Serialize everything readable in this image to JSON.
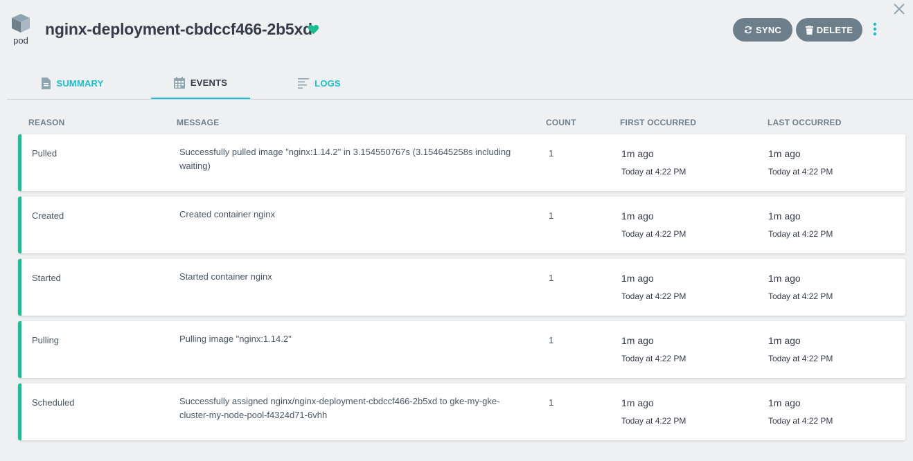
{
  "header": {
    "kind_label": "pod",
    "title": "nginx-deployment-cbdccf466-2b5xd",
    "health_color": "#18be94",
    "sync_label": "SYNC",
    "delete_label": "DELETE"
  },
  "tabs": [
    {
      "label": "SUMMARY",
      "icon": "document-icon",
      "active": false
    },
    {
      "label": "EVENTS",
      "icon": "calendar-icon",
      "active": true
    },
    {
      "label": "LOGS",
      "icon": "lines-icon",
      "active": false
    }
  ],
  "columns": {
    "reason": "REASON",
    "message": "MESSAGE",
    "count": "COUNT",
    "first": "FIRST OCCURRED",
    "last": "LAST OCCURRED"
  },
  "events": [
    {
      "reason": "Pulled",
      "message": "Successfully pulled image \"nginx:1.14.2\" in 3.154550767s (3.154645258s including waiting)",
      "count": "1",
      "first_rel": "1m ago",
      "first_abs": "Today at 4:22 PM",
      "last_rel": "1m ago",
      "last_abs": "Today at 4:22 PM"
    },
    {
      "reason": "Created",
      "message": "Created container nginx",
      "count": "1",
      "first_rel": "1m ago",
      "first_abs": "Today at 4:22 PM",
      "last_rel": "1m ago",
      "last_abs": "Today at 4:22 PM"
    },
    {
      "reason": "Started",
      "message": "Started container nginx",
      "count": "1",
      "first_rel": "1m ago",
      "first_abs": "Today at 4:22 PM",
      "last_rel": "1m ago",
      "last_abs": "Today at 4:22 PM"
    },
    {
      "reason": "Pulling",
      "message": "Pulling image \"nginx:1.14.2\"",
      "count": "1",
      "first_rel": "1m ago",
      "first_abs": "Today at 4:22 PM",
      "last_rel": "1m ago",
      "last_abs": "Today at 4:22 PM"
    },
    {
      "reason": "Scheduled",
      "message": "Successfully assigned nginx/nginx-deployment-cbdccf466-2b5xd to gke-my-gke-cluster-my-node-pool-f4324d71-6vhh",
      "count": "1",
      "first_rel": "1m ago",
      "first_abs": "Today at 4:22 PM",
      "last_rel": "1m ago",
      "last_abs": "Today at 4:22 PM"
    }
  ],
  "colors": {
    "accent": "#18bed4",
    "success": "#18be94",
    "button": "#6d7f8b",
    "text": "#363c4a"
  }
}
